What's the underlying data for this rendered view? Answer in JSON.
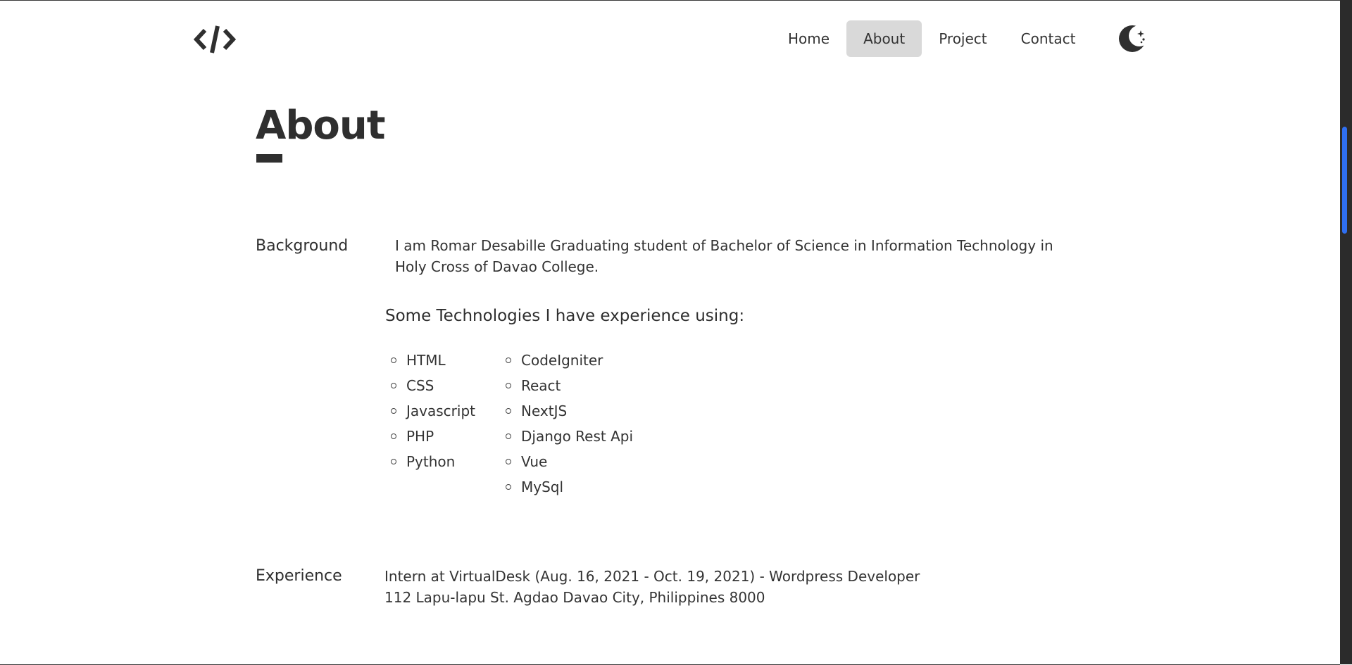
{
  "header": {
    "logo_icon": "code-brackets-icon",
    "nav": [
      {
        "label": "Home",
        "active": false
      },
      {
        "label": "About",
        "active": true
      },
      {
        "label": "Project",
        "active": false
      },
      {
        "label": "Contact",
        "active": false
      }
    ],
    "theme_toggle_icon": "moon-stars-icon"
  },
  "page": {
    "title": "About"
  },
  "background": {
    "label": "Background",
    "text": "I am Romar Desabille Graduating student of Bachelor of Science in Information Technology in Holy Cross of Davao College."
  },
  "technologies": {
    "heading": "Some Technologies I have experience using:",
    "column_a": [
      "HTML",
      "CSS",
      "Javascript",
      "PHP",
      "Python"
    ],
    "column_b": [
      "CodeIgniter",
      "React",
      "NextJS",
      "Django Rest Api",
      "Vue",
      "MySql"
    ]
  },
  "experience": {
    "label": "Experience",
    "line1": "Intern at VirtualDesk (Aug. 16, 2021 - Oct. 19, 2021) - Wordpress Developer",
    "line2": "112 Lapu-lapu St. Agdao Davao City, Philippines 8000"
  },
  "colors": {
    "text": "#2f2f2f",
    "nav_active_bg": "#d9d9d9",
    "scrollbar_thumb": "#2f6ff2"
  }
}
